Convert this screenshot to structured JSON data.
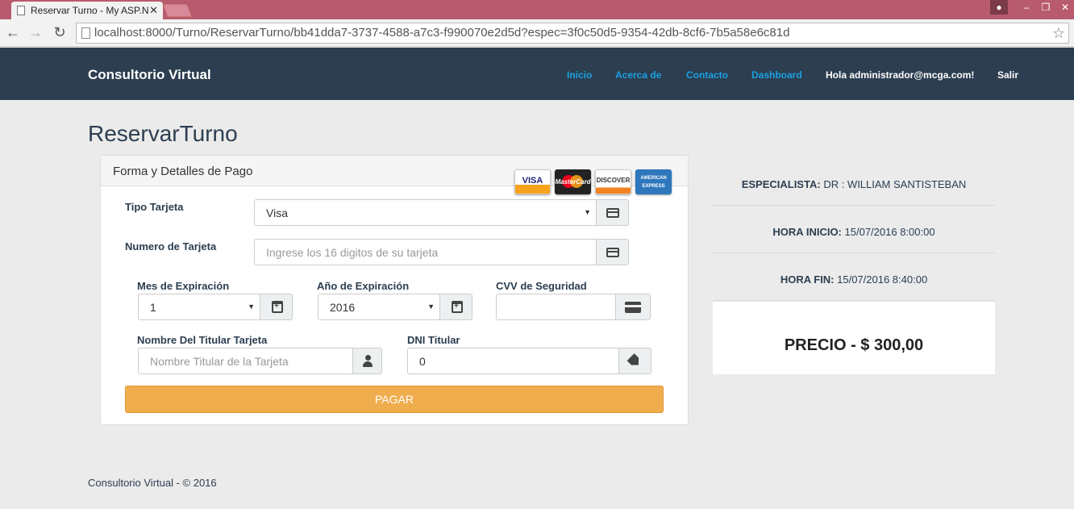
{
  "browser": {
    "tab_title": "Reservar Turno - My ASP.N",
    "url": "localhost:8000/Turno/ReservarTurno/bb41dda7-3737-4588-a7c3-f990070e2d5d?espec=3f0c50d5-9354-42db-8cf6-7b5a58e6c81d"
  },
  "navbar": {
    "brand": "Consultorio Virtual",
    "links": [
      "Inicio",
      "Acerca de",
      "Contacto",
      "Dashboard"
    ],
    "greeting": "Hola administrador@mcga.com!",
    "logout": "Salir"
  },
  "page_title": "ReservarTurno",
  "panel": {
    "title": "Forma y Detalles de Pago",
    "cards": [
      "VISA",
      "MasterCard",
      "DISCOVER",
      "AMERICAN EXPRESS"
    ],
    "card_type": {
      "label": "Tipo Tarjeta",
      "value": "Visa"
    },
    "card_number": {
      "label": "Numero de Tarjeta",
      "placeholder": "Ingrese los 16 digitos de su tarjeta"
    },
    "exp_month": {
      "label": "Mes de Expiración",
      "value": "1"
    },
    "exp_year": {
      "label": "Año de Expiración",
      "value": "2016"
    },
    "cvv": {
      "label": "CVV de Seguridad",
      "value": ""
    },
    "holder_name": {
      "label": "Nombre Del Titular Tarjeta",
      "placeholder": "Nombre Titular de la Tarjeta"
    },
    "dni": {
      "label": "DNI Titular",
      "value": "0"
    },
    "pay_button": "PAGAR"
  },
  "summary": {
    "especialista": {
      "label": "ESPECIALISTA:",
      "value": "DR : WILLIAM SANTISTEBAN"
    },
    "hora_inicio": {
      "label": "HORA INICIO:",
      "value": "15/07/2016 8:00:00"
    },
    "hora_fin": {
      "label": "HORA FIN:",
      "value": "15/07/2016 8:40:00"
    },
    "precio": "PRECIO - $ 300,00"
  },
  "footer": "Consultorio Virtual - © 2016"
}
